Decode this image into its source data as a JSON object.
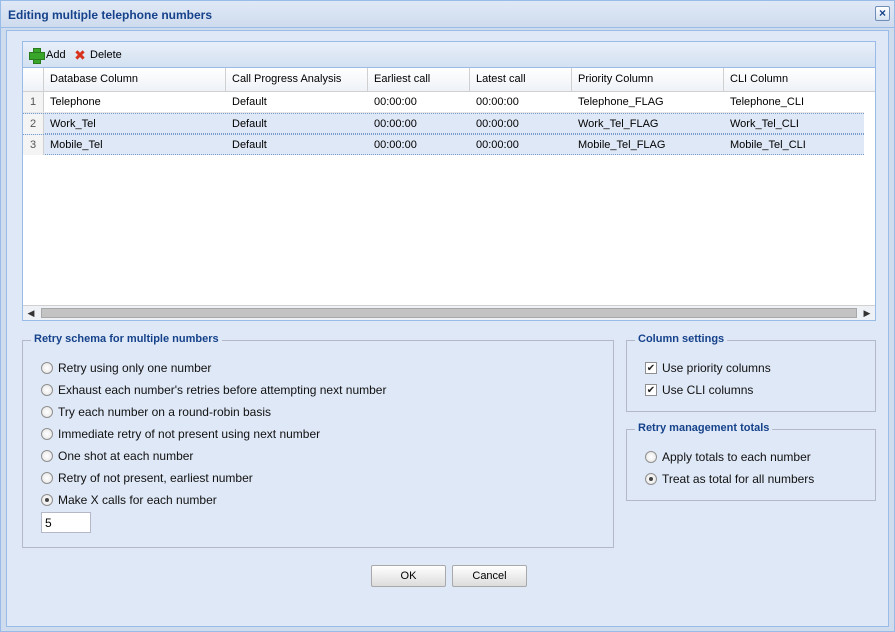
{
  "window": {
    "title": "Editing multiple telephone numbers"
  },
  "toolbar": {
    "add_label": "Add",
    "delete_label": "Delete"
  },
  "grid": {
    "columns": [
      "Database Column",
      "Call Progress Analysis",
      "Earliest call",
      "Latest call",
      "Priority Column",
      "CLI Column"
    ],
    "rows": [
      {
        "num": "1",
        "db": "Telephone",
        "cpa": "Default",
        "earliest": "00:00:00",
        "latest": "00:00:00",
        "priority": "Telephone_FLAG",
        "cli": "Telephone_CLI"
      },
      {
        "num": "2",
        "db": "Work_Tel",
        "cpa": "Default",
        "earliest": "00:00:00",
        "latest": "00:00:00",
        "priority": "Work_Tel_FLAG",
        "cli": "Work_Tel_CLI"
      },
      {
        "num": "3",
        "db": "Mobile_Tel",
        "cpa": "Default",
        "earliest": "00:00:00",
        "latest": "00:00:00",
        "priority": "Mobile_Tel_FLAG",
        "cli": "Mobile_Tel_CLI"
      }
    ]
  },
  "retry_schema": {
    "legend": "Retry schema for multiple numbers",
    "options": [
      "Retry using only one number",
      "Exhaust each number's retries before attempting next number",
      "Try each number on a round-robin basis",
      "Immediate retry of not present using next number",
      "One shot at each number",
      "Retry of not present, earliest number",
      "Make X calls for each number"
    ],
    "x_value": "5"
  },
  "column_settings": {
    "legend": "Column settings",
    "use_priority": "Use priority columns",
    "use_cli": "Use CLI columns"
  },
  "retry_totals": {
    "legend": "Retry management totals",
    "apply_each": "Apply totals to each number",
    "treat_total": "Treat as total for all numbers"
  },
  "buttons": {
    "ok": "OK",
    "cancel": "Cancel"
  }
}
